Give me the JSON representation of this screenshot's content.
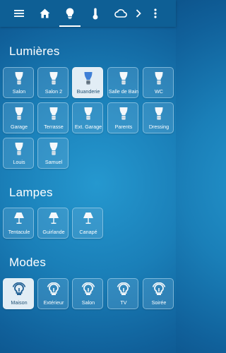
{
  "topbar": {
    "items": [
      {
        "name": "menu-icon"
      },
      {
        "name": "home-icon"
      },
      {
        "name": "lightbulb-icon"
      },
      {
        "name": "thermometer-icon"
      },
      {
        "name": "cloud-icon"
      },
      {
        "name": "chevron-right-icon"
      },
      {
        "name": "more-vertical-icon"
      }
    ],
    "active_tab": "lightbulb-icon"
  },
  "colors": {
    "topbar_bg": "#0e5f95",
    "tile_active_bg": "#e2edf5",
    "bulb_active_accent": "#3f7fd6"
  },
  "sections": {
    "lumieres": {
      "title": "Lumières",
      "tiles": [
        {
          "label": "Salon",
          "icon": "bulb-icon",
          "active": false
        },
        {
          "label": "Salon 2",
          "icon": "bulb-icon",
          "active": false
        },
        {
          "label": "Buanderie",
          "icon": "bulb-icon",
          "active": true
        },
        {
          "label": "Salle de Bain",
          "icon": "bulb-icon",
          "active": false
        },
        {
          "label": "WC",
          "icon": "bulb-icon",
          "active": false
        },
        {
          "label": "Garage",
          "icon": "bulb-icon",
          "active": false
        },
        {
          "label": "Terrasse",
          "icon": "bulb-icon",
          "active": false
        },
        {
          "label": "Ext. Garage",
          "icon": "bulb-icon",
          "active": false
        },
        {
          "label": "Parents",
          "icon": "bulb-icon",
          "active": false
        },
        {
          "label": "Dressing",
          "icon": "bulb-icon",
          "active": false
        },
        {
          "label": "Louis",
          "icon": "bulb-icon",
          "active": false
        },
        {
          "label": "Samuel",
          "icon": "bulb-icon",
          "active": false
        }
      ]
    },
    "lampes": {
      "title": "Lampes",
      "tiles": [
        {
          "label": "Tentacule",
          "icon": "lamp-icon",
          "active": false
        },
        {
          "label": "Guirlande",
          "icon": "lamp-icon",
          "active": false
        },
        {
          "label": "Canapé",
          "icon": "lamp-icon",
          "active": false
        }
      ]
    },
    "modes": {
      "title": "Modes",
      "tiles": [
        {
          "label": "Maison",
          "icon": "mode-icon",
          "active": true
        },
        {
          "label": "Extérieur",
          "icon": "mode-icon",
          "active": false
        },
        {
          "label": "Salon",
          "icon": "mode-icon",
          "active": false
        },
        {
          "label": "TV",
          "icon": "mode-icon",
          "active": false
        },
        {
          "label": "Soirée",
          "icon": "mode-icon",
          "active": false
        }
      ]
    }
  }
}
